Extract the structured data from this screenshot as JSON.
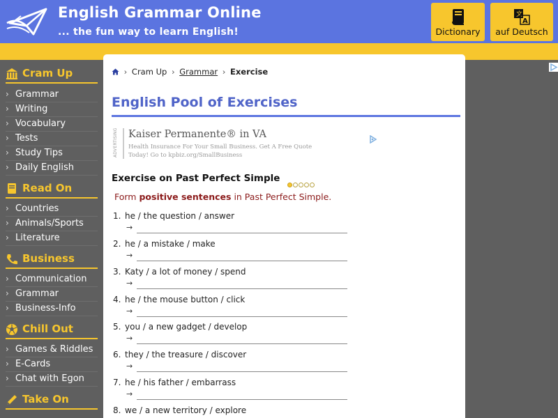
{
  "header": {
    "title": "English Grammar Online",
    "tagline": "... the fun way to learn English!",
    "buttons": [
      {
        "label": "Dictionary",
        "icon": "book-icon"
      },
      {
        "label": "auf Deutsch",
        "icon": "translate-icon"
      }
    ]
  },
  "colors": {
    "header_blue": "#5b74e0",
    "accent_yellow": "#f7c62d",
    "sidebar_gray": "#5f5f5f",
    "title_blue": "#5064c8",
    "instruction_red": "#8b1a1a"
  },
  "sidebar": {
    "sections": [
      {
        "title": "Cram Up",
        "icon": "building-icon",
        "items": [
          "Grammar",
          "Writing",
          "Vocabulary",
          "Tests",
          "Study Tips",
          "Daily English"
        ]
      },
      {
        "title": "Read On",
        "icon": "book-icon",
        "items": [
          "Countries",
          "Animals/Sports",
          "Literature"
        ]
      },
      {
        "title": "Business",
        "icon": "phone-icon",
        "items": [
          "Communication",
          "Grammar",
          "Business-Info"
        ]
      },
      {
        "title": "Chill Out",
        "icon": "soccer-ball-icon",
        "items": [
          "Games & Riddles",
          "E-Cards",
          "Chat with Egon"
        ]
      },
      {
        "title": "Take On",
        "icon": "pen-icon",
        "items": []
      }
    ]
  },
  "breadcrumb": {
    "home_icon": "home-icon",
    "items": [
      "Cram Up",
      "Grammar",
      "Exercise"
    ]
  },
  "main": {
    "title": "English Pool of Exercises",
    "ad": {
      "label": "ADVERTISING",
      "headline": "Kaiser Permanente® in VA",
      "text": "Health Insurance For Your Small Business. Get A Free Quote Today! Go to kpbiz.org/SmallBusiness"
    },
    "exercise_title": "Exercise on Past Perfect Simple",
    "difficulty": {
      "level": 1,
      "max": 5
    },
    "instruction": {
      "before": "Form ",
      "bold": "positive sentences",
      "after": " in Past Perfect Simple."
    },
    "arrow": "→",
    "tasks": [
      {
        "num": "1.",
        "prompt": "he / the question / answer",
        "answer": ""
      },
      {
        "num": "2.",
        "prompt": "he / a mistake / make",
        "answer": ""
      },
      {
        "num": "3.",
        "prompt": "Katy / a lot of money / spend",
        "answer": ""
      },
      {
        "num": "4.",
        "prompt": "he / the mouse button / click",
        "answer": ""
      },
      {
        "num": "5.",
        "prompt": "you / a new gadget / develop",
        "answer": ""
      },
      {
        "num": "6.",
        "prompt": "they / the treasure / discover",
        "answer": ""
      },
      {
        "num": "7.",
        "prompt": "he / his father / embarrass",
        "answer": ""
      },
      {
        "num": "8.",
        "prompt": "we / a new territory / explore",
        "answer": ""
      }
    ]
  }
}
